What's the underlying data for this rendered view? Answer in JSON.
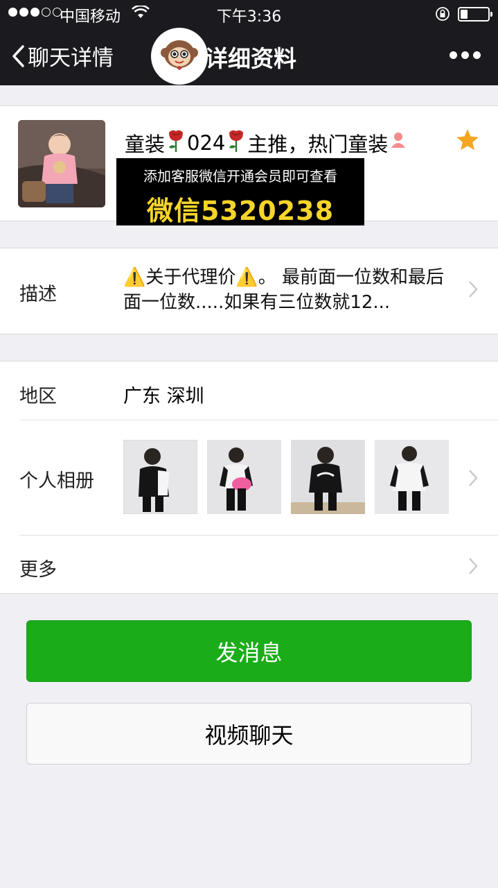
{
  "status_bar": {
    "carrier": "中国移动",
    "time": "下午3:36",
    "signal_bars_filled": 3,
    "signal_bars_total": 5,
    "battery_level": 0.25
  },
  "nav": {
    "back_label": "聊天详情",
    "title": "详细资料"
  },
  "profile": {
    "nickname_parts": [
      "童装",
      "024",
      "主推，热门童装"
    ],
    "starred": true
  },
  "ad_overlay": {
    "line1": "添加客服微信开通会员即可查看",
    "line2": "微信5320238"
  },
  "description": {
    "label": "描述",
    "text": "⚠️关于代理价⚠️。 最前面一位数和最后面一位数.....如果有三位数就12..."
  },
  "region": {
    "label": "地区",
    "value": "广东 深圳"
  },
  "album": {
    "label": "个人相册",
    "photo_count": 4
  },
  "more": {
    "label": "更多"
  },
  "buttons": {
    "send_message": "发消息",
    "video_chat": "视频聊天"
  },
  "colors": {
    "nav_bg": "#1b1b1f",
    "primary_green": "#1aad19",
    "page_bg": "#efeff4",
    "ad_yellow": "#f6d52a",
    "star": "#f4a623"
  }
}
